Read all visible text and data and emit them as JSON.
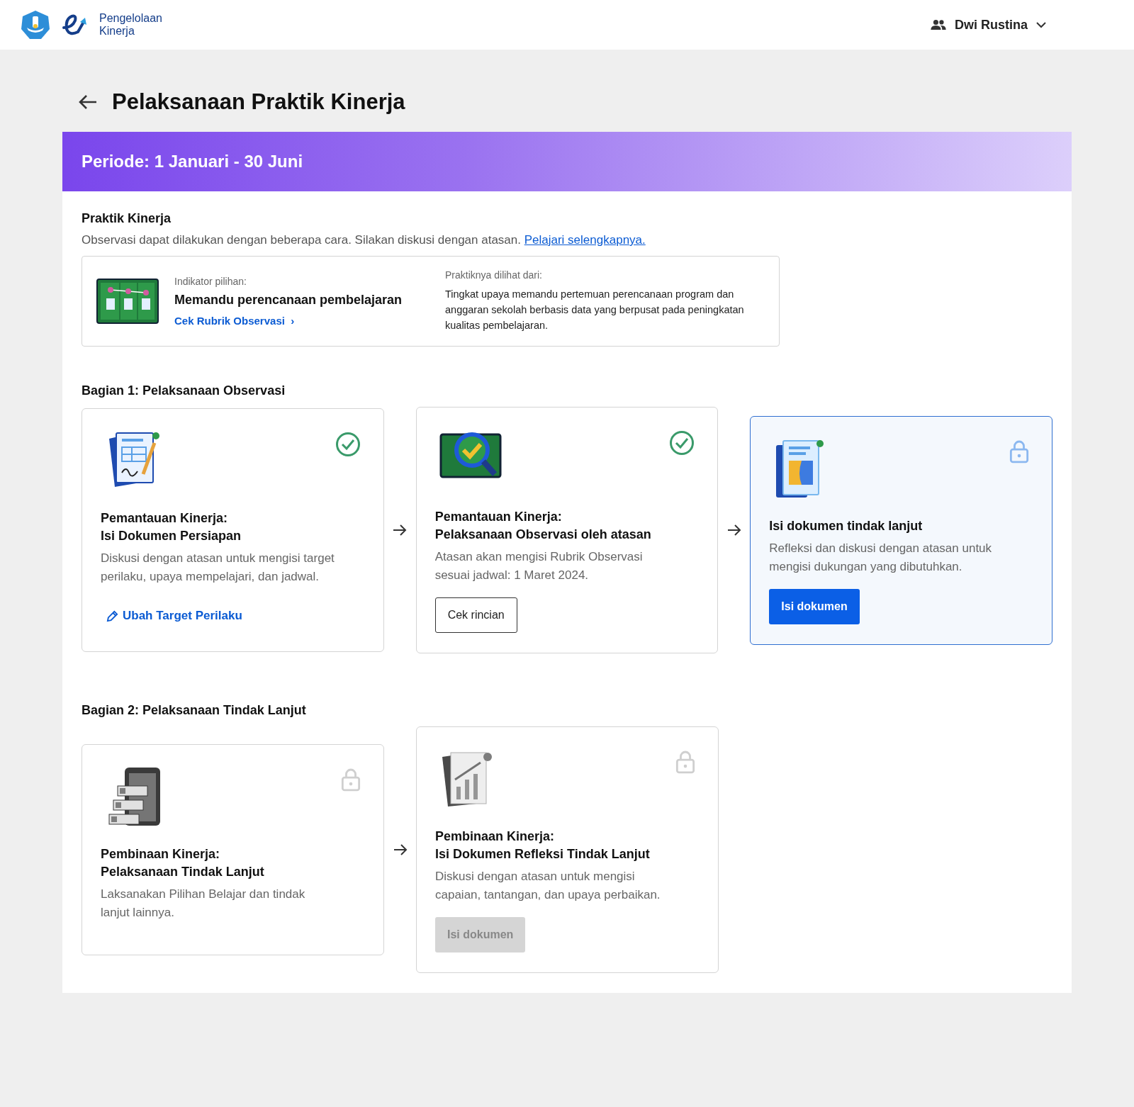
{
  "header": {
    "logo_text_lines": [
      "Pengelolaan",
      "Kinerja"
    ],
    "user_name": "Dwi Rustina"
  },
  "page_title": "Pelaksanaan Praktik Kinerja",
  "period_banner": "Periode: 1 Januari - 30 Juni",
  "practice": {
    "heading": "Praktik Kinerja",
    "intro": "Observasi dapat dilakukan dengan beberapa cara. Silakan diskusi dengan atasan.",
    "intro_link": "Pelajari selengkapnya.",
    "indicator_label": "Indikator pilihan:",
    "indicator_value": "Memandu perencanaan pembelajaran",
    "rubric_link": "Cek Rubrik Observasi",
    "rubric_link_icon": "›",
    "seen_from_label": "Praktiknya dilihat dari:",
    "seen_from_text": "Tingkat upaya memandu pertemuan perencanaan program dan anggaran sekolah berbasis data yang berpusat pada peningkatan kualitas pembelajaran."
  },
  "sections": [
    {
      "title": "Bagian 1: Pelaksanaan Observasi",
      "cards": [
        {
          "kind": "form",
          "completed": true,
          "locked": false,
          "highlighted": false,
          "disabled": false,
          "title_lines": [
            "Pemantauan Kinerja:",
            "Isi Dokumen Persiapan"
          ],
          "description": "Diskusi dengan atasan untuk mengisi target perilaku, upaya mempelajari, dan jadwal.",
          "action": {
            "kind": "link",
            "label": "Ubah Target Perilaku"
          }
        },
        {
          "kind": "magnifier",
          "completed": true,
          "locked": false,
          "highlighted": false,
          "disabled": false,
          "title_lines": [
            "Pemantauan Kinerja:",
            "Pelaksanaan Observasi oleh atasan"
          ],
          "description": "Atasan akan mengisi Rubrik Observasi sesuai jadwal: 1 Maret 2024.",
          "action": {
            "kind": "outline",
            "label": "Cek rincian"
          }
        },
        {
          "kind": "document",
          "completed": false,
          "locked": true,
          "highlighted": true,
          "disabled": false,
          "title_lines": [
            "Isi dokumen tindak lanjut"
          ],
          "description": "Refleksi dan diskusi dengan atasan untuk mengisi dukungan yang dibutuhkan.",
          "action": {
            "kind": "primary",
            "label": "Isi dokumen"
          }
        }
      ]
    },
    {
      "title": "Bagian 2: Pelaksanaan Tindak Lanjut",
      "cards": [
        {
          "kind": "checklist",
          "completed": false,
          "locked": true,
          "highlighted": false,
          "disabled": true,
          "title_lines": [
            "Pembinaan Kinerja:",
            "Pelaksanaan Tindak Lanjut"
          ],
          "description": "Laksanakan Pilihan Belajar dan tindak lanjut lainnya."
        },
        {
          "kind": "report",
          "completed": false,
          "locked": true,
          "highlighted": false,
          "disabled": true,
          "title_lines": [
            "Pembinaan Kinerja:",
            "Isi Dokumen Refleksi Tindak Lanjut"
          ],
          "description": "Diskusi dengan atasan untuk mengisi capaian, tantangan, dan upaya perbaikan.",
          "action": {
            "kind": "primary",
            "label": "Isi dokumen"
          }
        }
      ]
    }
  ]
}
